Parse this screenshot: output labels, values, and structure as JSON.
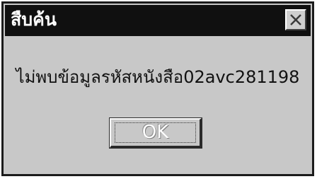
{
  "dialog": {
    "title": "สืบค้น",
    "message": "ไม่พบข้อมูลรหัสหนังสือ02avc281198",
    "ok_label": "OK",
    "close_icon": "close-icon",
    "colors": {
      "titlebar": "#101010",
      "body": "#c8c8c8",
      "title_text": "#ffffff"
    }
  }
}
